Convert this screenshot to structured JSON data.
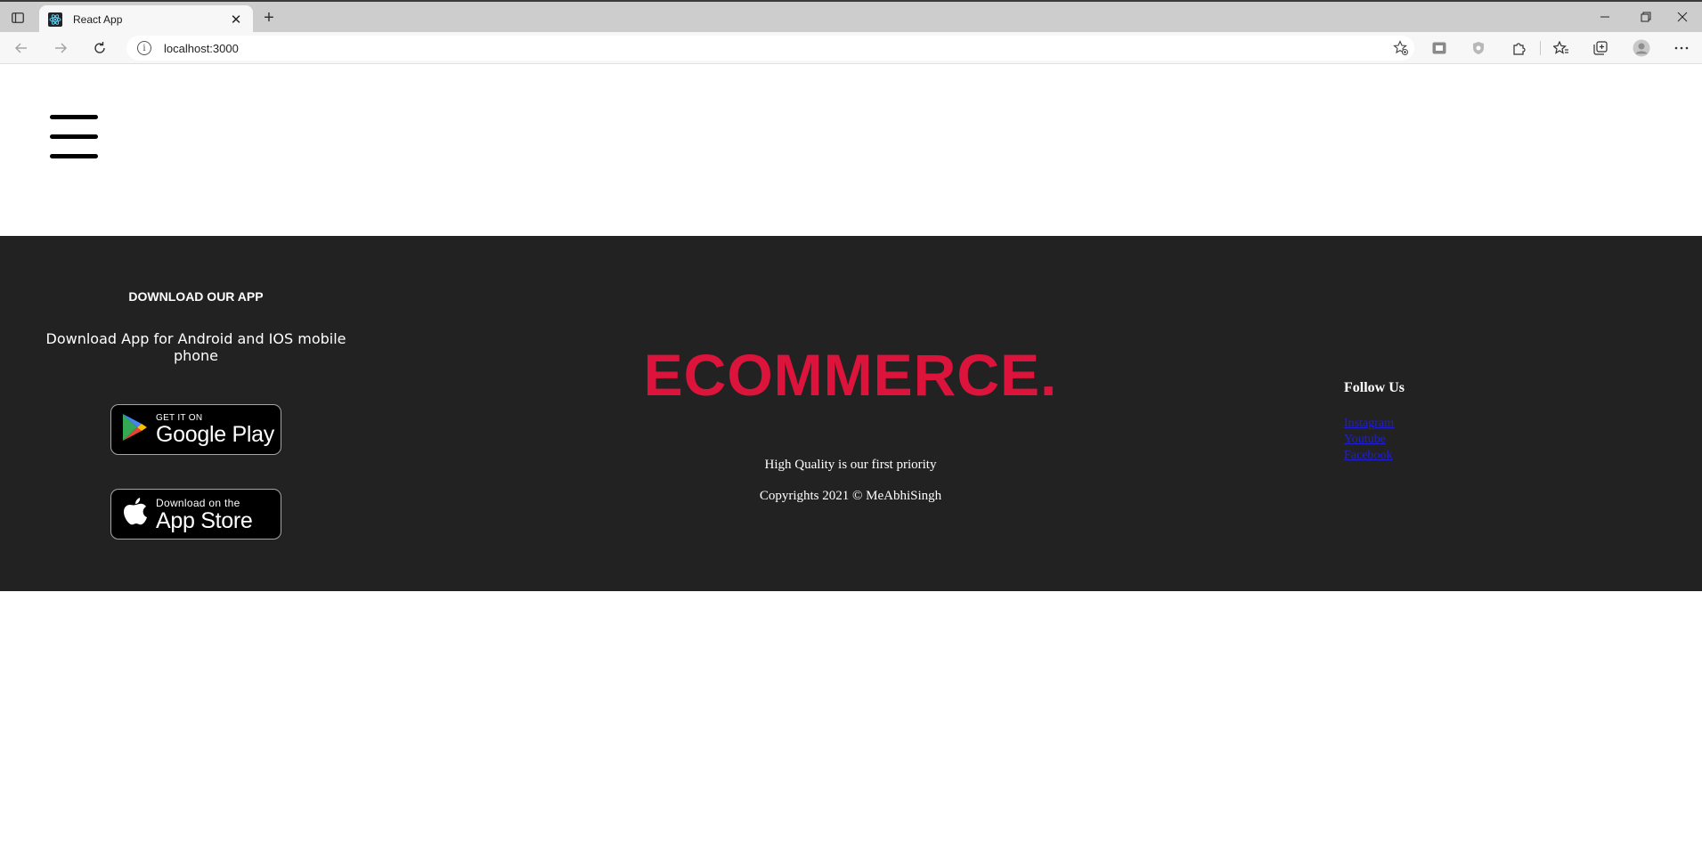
{
  "browser": {
    "tab_title": "React App",
    "tab_close": "✕",
    "new_tab": "+",
    "url": "localhost:3000",
    "info_glyph": "i",
    "icons": [
      "tab-actions-icon",
      "react-favicon-icon",
      "back-icon",
      "forward-icon",
      "refresh-icon",
      "add-favorite-icon",
      "extension-icon",
      "shield-icon",
      "puzzle-icon",
      "favorites-icon",
      "collections-icon",
      "profile-icon",
      "more-icon",
      "minimize-icon",
      "restore-icon",
      "close-icon"
    ]
  },
  "page": {
    "menu_icon": "hamburger-menu-icon"
  },
  "footer": {
    "background": "#222222",
    "left": {
      "heading": "DOWNLOAD OUR APP",
      "description": "Download App for Android and IOS mobile phone",
      "google_play": {
        "small": "GET IT ON",
        "big": "Google Play"
      },
      "app_store": {
        "small": "Download on the",
        "big": "App Store"
      }
    },
    "middle": {
      "brand": "ECOMMERCE.",
      "brand_color": "#dc143c",
      "tagline": "High Quality is our first priority",
      "copyright": "Copyrights 2021 © MeAbhiSingh"
    },
    "right": {
      "heading": "Follow Us",
      "links": [
        "Instagram",
        "Youtube",
        "Facebook"
      ]
    }
  }
}
